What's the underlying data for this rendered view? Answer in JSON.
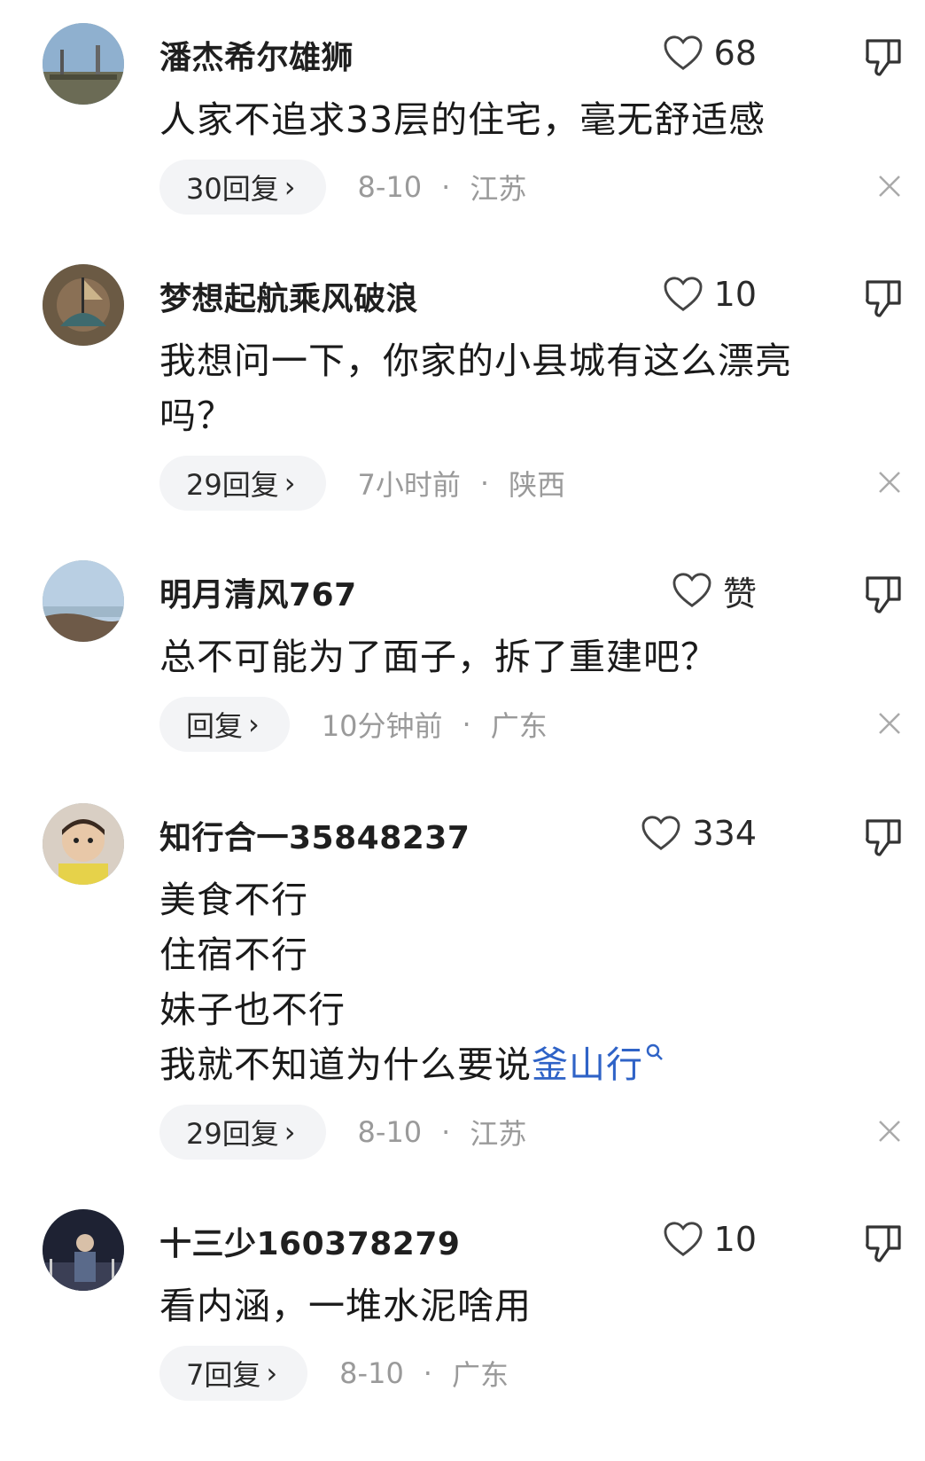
{
  "comments": [
    {
      "username": "潘杰希尔雄狮",
      "likes": "68",
      "lines": [
        "人家不追求33层的住宅，毫无舒适感"
      ],
      "reply_label": "30回复",
      "time": "8-10",
      "location": "江苏"
    },
    {
      "username": "梦想起航乘风破浪",
      "likes": "10",
      "lines": [
        "我想问一下，你家的小县城有这么漂亮",
        "吗？"
      ],
      "reply_label": "29回复",
      "time": "7小时前",
      "location": "陕西"
    },
    {
      "username": "明月清风767",
      "likes": "赞",
      "lines": [
        "总不可能为了面子，拆了重建吧？"
      ],
      "reply_label": "回复",
      "time": "10分钟前",
      "location": "广东"
    },
    {
      "username": "知行合一35848237",
      "likes": "334",
      "lines": [
        "美食不行",
        "住宿不行",
        "妹子也不行",
        "我就不知道为什么要说"
      ],
      "link_text": "釜山行",
      "reply_label": "29回复",
      "time": "8-10",
      "location": "江苏"
    },
    {
      "username": "十三少160378279",
      "likes": "10",
      "lines": [
        "看内涵，一堆水泥啥用"
      ],
      "reply_label": "7回复",
      "time": "8-10",
      "location": "广东"
    }
  ],
  "icons": {
    "like": "heart-outline-icon",
    "dislike": "thumbs-down-icon",
    "close": "close-icon",
    "search": "search-icon",
    "chevron": "chevron-right-icon"
  },
  "colors": {
    "link": "#2f63c7",
    "meta": "#9a9a9a",
    "pill": "#f3f4f6"
  }
}
